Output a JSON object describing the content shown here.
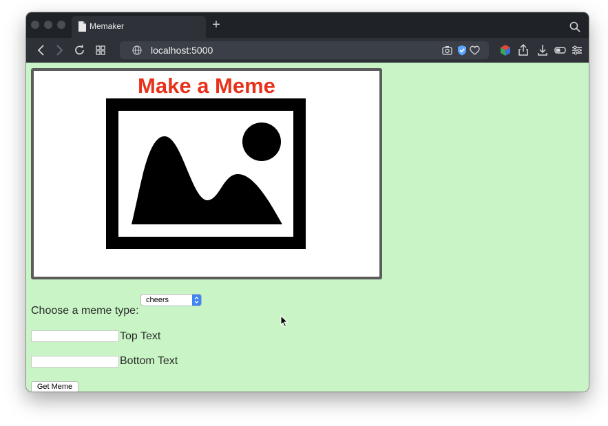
{
  "browser": {
    "tab_title": "Memaker",
    "new_tab_symbol": "+",
    "address": "localhost:5000"
  },
  "page": {
    "meme_heading": "Make a Meme",
    "meme_type_label": "Choose a meme type:",
    "meme_type_selected": "cheers",
    "top_text_label": "Top Text",
    "top_text_value": "",
    "bottom_text_label": "Bottom Text",
    "bottom_text_value": "",
    "submit_label": "Get Meme"
  },
  "colors": {
    "page_background": "#c9f5c6",
    "heading": "#e8311a",
    "select_accent": "#3d86f2"
  },
  "icons": [
    "file-icon",
    "search-icon",
    "back-icon",
    "forward-icon",
    "reload-icon",
    "tab-grid-icon",
    "globe-icon",
    "camera-icon",
    "shield-check-icon",
    "heart-icon",
    "extension-cube-icon",
    "share-icon",
    "download-icon",
    "battery-icon",
    "settings-sliders-icon",
    "image-placeholder-icon",
    "mouse-pointer-icon"
  ]
}
